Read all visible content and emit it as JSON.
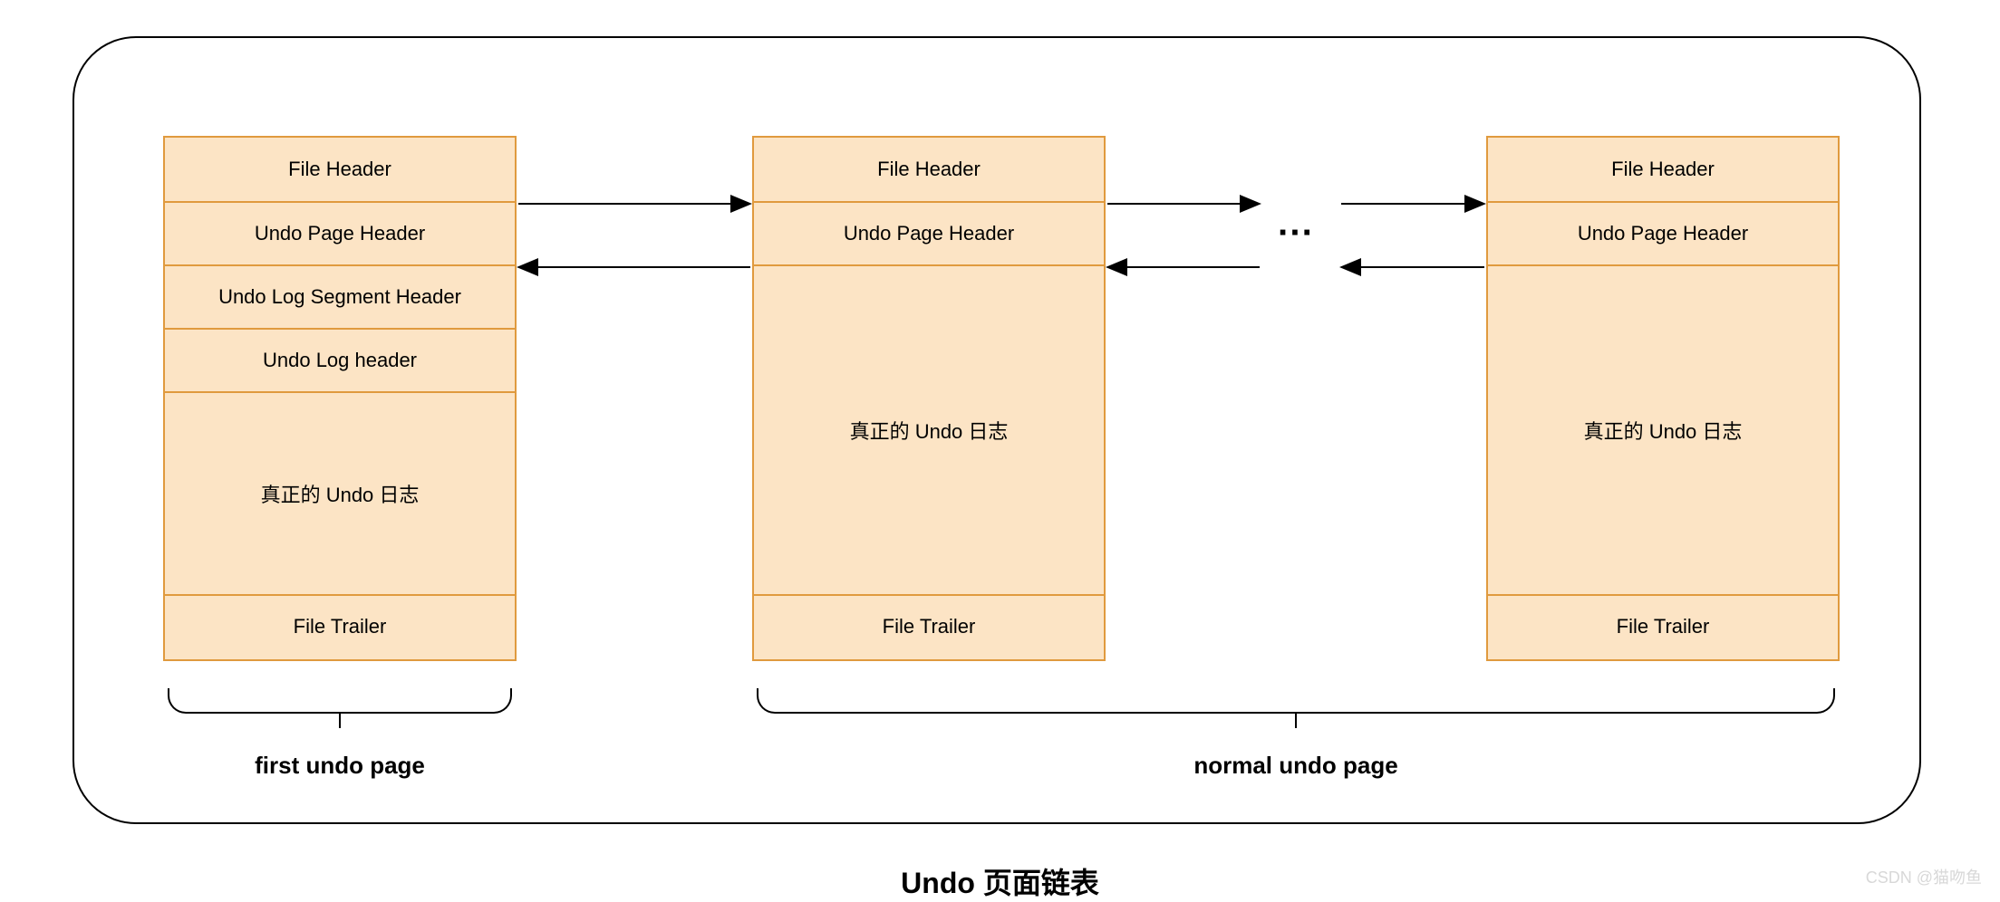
{
  "page1": {
    "fileHeader": "File Header",
    "undoPageHeader": "Undo Page Header",
    "undoLogSegmentHeader": "Undo Log Segment Header",
    "undoLogHeader": "Undo Log header",
    "realUndoLog": "真正的 Undo 日志",
    "fileTrailer": "File Trailer"
  },
  "page2": {
    "fileHeader": "File Header",
    "undoPageHeader": "Undo Page Header",
    "realUndoLog": "真正的 Undo 日志",
    "fileTrailer": "File Trailer"
  },
  "page3": {
    "fileHeader": "File Header",
    "undoPageHeader": "Undo Page Header",
    "realUndoLog": "真正的 Undo 日志",
    "fileTrailer": "File Trailer"
  },
  "ellipsis": "···",
  "brace1Label": "first undo page",
  "brace2Label": "normal undo page",
  "caption": "Undo 页面链表",
  "watermark": "CSDN @猫吻鱼"
}
